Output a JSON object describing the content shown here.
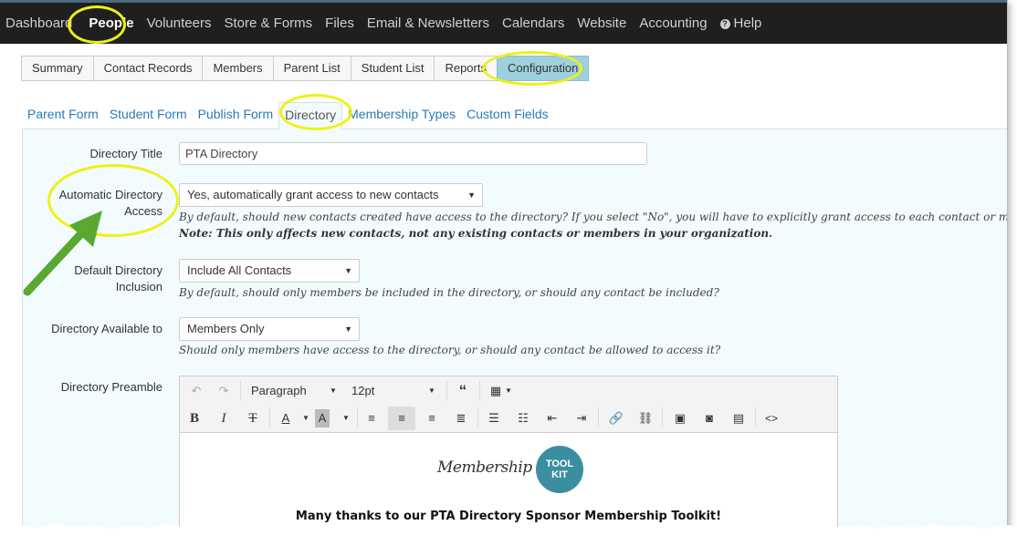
{
  "topnav": {
    "items": [
      "Dashboard",
      "People",
      "Volunteers",
      "Store & Forms",
      "Files",
      "Email & Newsletters",
      "Calendars",
      "Website",
      "Accounting"
    ],
    "active": "People",
    "help_label": "Help",
    "help_icon": "question-circle-icon"
  },
  "subtabs": {
    "items": [
      "Summary",
      "Contact Records",
      "Members",
      "Parent List",
      "Student List",
      "Reports",
      "Configuration"
    ],
    "active": "Configuration"
  },
  "cfgtabs": {
    "items": [
      "Parent Form",
      "Student Form",
      "Publish Form",
      "Directory",
      "Membership Types",
      "Custom Fields"
    ],
    "active": "Directory"
  },
  "form": {
    "directory_title": {
      "label": "Directory Title",
      "value": "PTA Directory"
    },
    "auto_access": {
      "label_line1": "Automatic Directory",
      "label_line2": "Access",
      "value": "Yes, automatically grant access to new contacts",
      "help": "By default, should new contacts created have access to the directory? If you select \"No\", you will have to explicitly grant access to each contact or member.",
      "note": "Note: This only affects new contacts, not any existing contacts or members in your organization."
    },
    "default_inclusion": {
      "label_line1": "Default Directory",
      "label_line2": "Inclusion",
      "value": "Include All Contacts",
      "help": "By default, should only members be included in the directory, or should any contact be included?"
    },
    "available_to": {
      "label": "Directory Available to",
      "value": "Members Only",
      "help": "Should only members have access to the directory, or should any contact be allowed to access it?"
    },
    "preamble": {
      "label": "Directory Preamble",
      "toolbar": {
        "format": "Paragraph",
        "size": "12pt"
      },
      "logo_script": "Membership",
      "logo_badge_line1": "TOOL",
      "logo_badge_line2": "KIT",
      "thanks": "Many thanks to our PTA Directory Sponsor Membership Toolkit!"
    }
  },
  "colors": {
    "nav_bg": "#1f1f1f",
    "active_subtab": "#9fd0dd",
    "link": "#2a7ab8",
    "panel_bg": "#f2fcfe",
    "highlight": "#f0f016",
    "arrow": "#5aa832",
    "logo_badge": "#3a8ea0"
  }
}
